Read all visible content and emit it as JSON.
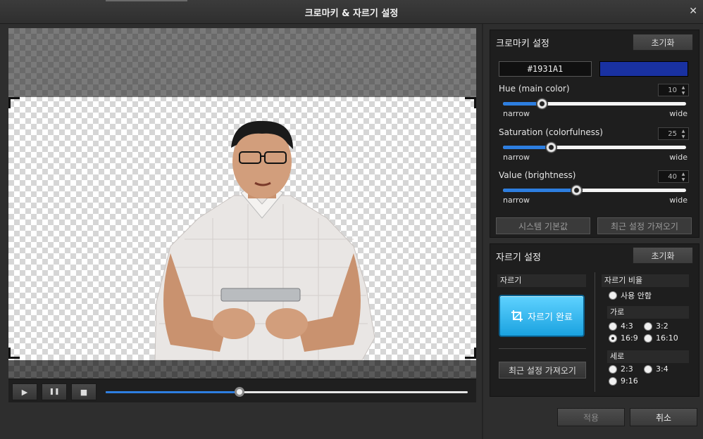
{
  "window": {
    "title": "크로마키 & 자르기 설정",
    "close_glyph": "✕"
  },
  "player": {
    "play_glyph": "▶",
    "pause_glyph": "❚❚",
    "stop_glyph": "■",
    "progress": 0.37
  },
  "chroma": {
    "header": "크로마키 설정",
    "reset_label": "초기화",
    "hex_value": "#1931A1",
    "swatch_color": "#1931A1",
    "sliders": [
      {
        "label": "Hue (main color)",
        "value": "10",
        "level": 0.21,
        "low": "narrow",
        "high": "wide"
      },
      {
        "label": "Saturation (colorfulness)",
        "value": "25",
        "level": 0.26,
        "low": "narrow",
        "high": "wide"
      },
      {
        "label": "Value (brightness)",
        "value": "40",
        "level": 0.4,
        "low": "narrow",
        "high": "wide"
      }
    ],
    "system_default_label": "시스템 기본값",
    "recent_settings_label": "최근 설정 가져오기"
  },
  "crop": {
    "header": "자르기 설정",
    "reset_label": "초기화",
    "crop_section_label": "자르기",
    "crop_done_label": "자르기 완료",
    "recent_settings_label": "최근 설정 가져오기",
    "ratio_label": "자르기 비율",
    "none_label": "사용 안함",
    "landscape_label": "가로",
    "portrait_label": "세로",
    "landscape_options": [
      "4:3",
      "3:2",
      "16:9",
      "16:10"
    ],
    "portrait_options": [
      "2:3",
      "3:4",
      "9:16"
    ],
    "selected": "16:9"
  },
  "footer": {
    "apply_label": "적용",
    "cancel_label": "취소"
  },
  "colors": {
    "accent": "#2d7ee0",
    "crop_button": "#1aa2e0"
  }
}
